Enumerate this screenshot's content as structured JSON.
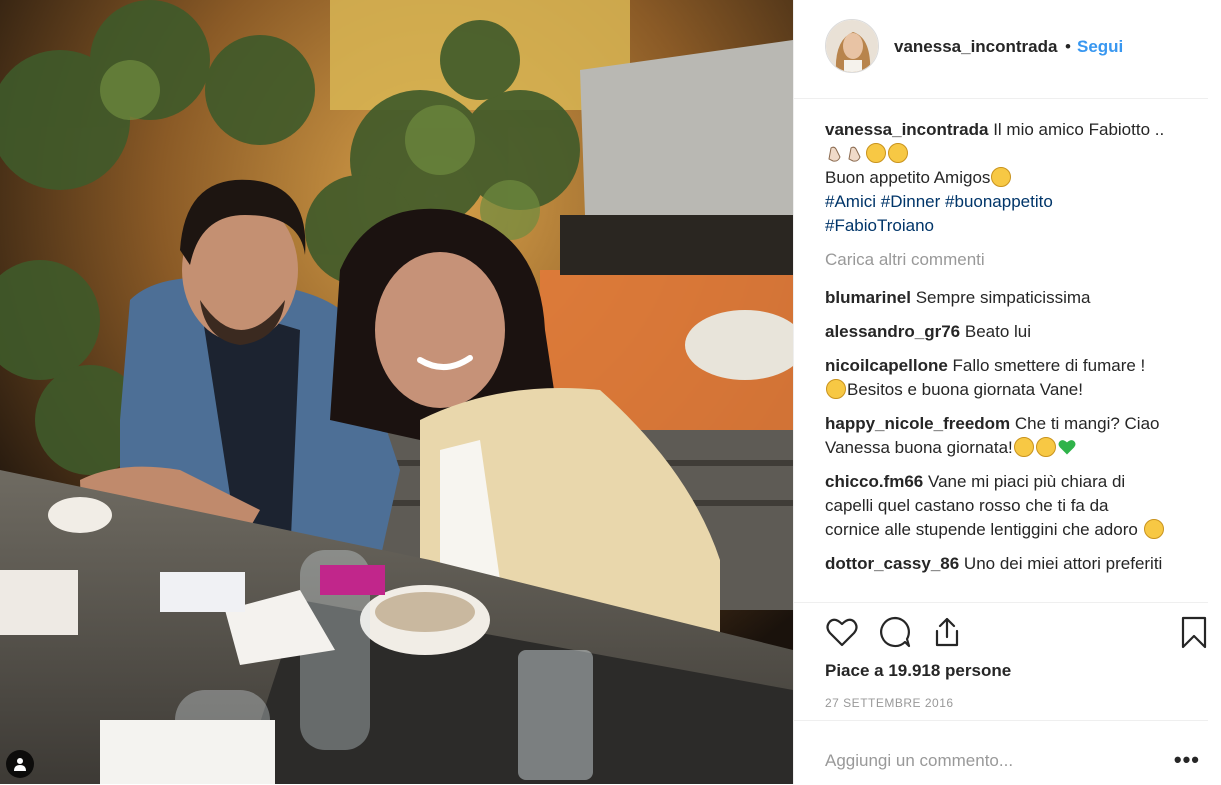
{
  "post": {
    "username": "vanessa_incontrada",
    "dot": "•",
    "follow_label": "Segui",
    "caption": {
      "line1": "Il mio amico Fabiotto ..",
      "line2": "Buon appetito Amigos",
      "hashtags": [
        "#Amici",
        "#Dinner",
        "#buonappetito",
        "#FabioTroiano"
      ]
    },
    "load_more": "Carica altri commenti",
    "comments": [
      {
        "user": "blumarinel",
        "text": "Sempre simpaticissima"
      },
      {
        "user": "alessandro_gr76",
        "text": "Beato lui"
      },
      {
        "user": "nicoilcapellone",
        "text": "Fallo smettere di fumare ! ",
        "text2": "Besitos e buona giornata Vane!"
      },
      {
        "user": "happy_nicole_freedom",
        "text": "Che ti mangi? Ciao Vanessa buona giornata!"
      },
      {
        "user": "chicco.fm66",
        "text": "Vane mi piaci più chiara di capelli quel castano rosso che ti fa da cornice alle stupende lentiggini che adoro "
      },
      {
        "user": "dottor_cassy_86",
        "text": "Uno dei miei attori preferiti"
      }
    ],
    "likes": "Piace a 19.918 persone",
    "date": "27 SETTEMBRE 2016",
    "add_comment_placeholder": "Aggiungi un commento...",
    "more_label": "•••"
  },
  "icons": {
    "like": "heart-icon",
    "comment": "comment-icon",
    "share": "share-icon",
    "save": "bookmark-icon",
    "tag": "user-tag-icon"
  },
  "colors": {
    "link": "#3897f0",
    "hashtag": "#003569",
    "muted": "#999999",
    "border": "#efefef"
  }
}
